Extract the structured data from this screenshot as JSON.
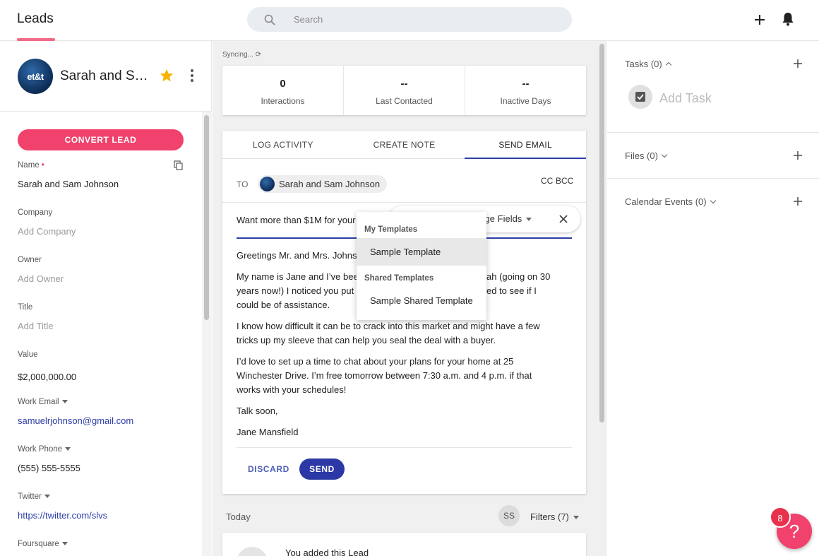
{
  "header": {
    "title": "Leads",
    "search_placeholder": "Search"
  },
  "lead": {
    "name": "Sarah and Sam Johnson",
    "avatar_text": "et&t",
    "convert_label": "CONVERT LEAD",
    "fields": {
      "name_label": "Name",
      "name_required": "•",
      "name_value": "Sarah and Sam Johnson",
      "company_label": "Company",
      "company_placeholder": "Add Company",
      "owner_label": "Owner",
      "owner_placeholder": "Add Owner",
      "title_label": "Title",
      "title_placeholder": "Add Title",
      "value_label": "Value",
      "value_value": "$2,000,000.00",
      "work_email_label": "Work Email",
      "work_email_value": "samuelrjohnson@gmail.com",
      "work_phone_label": "Work Phone",
      "work_phone_value": "(555) 555-5555",
      "twitter_label": "Twitter",
      "twitter_value": "https://twitter.com/slvs",
      "foursquare_label": "Foursquare"
    }
  },
  "stats": {
    "syncing": "Syncing...",
    "items": [
      {
        "value": "0",
        "label": "Interactions"
      },
      {
        "value": "--",
        "label": "Last Contacted"
      },
      {
        "value": "--",
        "label": "Inactive Days"
      }
    ]
  },
  "compose": {
    "tabs": [
      "LOG ACTIVITY",
      "CREATE NOTE",
      "SEND EMAIL"
    ],
    "active_tab": "SEND EMAIL",
    "to_label": "TO",
    "recipient": "Sarah and Sam Johnson",
    "cc_label": "CC",
    "bcc_label": "BCC",
    "subject": "Want more than $1M for your",
    "body_lines": [
      "Greetings Mr. and Mrs. Johns",
      "My name is Jane and I’ve bee",
      "ah (going on 30",
      "years now!) I noticed you put y",
      "ed to see if I",
      "could be of assistance.",
      "I know how difficult it can be to crack into this market and might have a few",
      "tricks up my sleeve that can help you seal the deal with a buyer.",
      "I’d love to set up a time to chat about your plans for your home at 25",
      "Winchester Drive. I’m free tomorrow between 7:30 a.m. and 4 p.m. if that",
      "works with your schedules!",
      "Talk soon,",
      "Jane Mansfield"
    ],
    "discard_label": "DISCARD",
    "send_label": "SEND",
    "merge_fields_label": "erge Fields"
  },
  "templates_dropdown": {
    "my_header": "My Templates",
    "my_items": [
      "Sample Template"
    ],
    "shared_header": "Shared Templates",
    "shared_items": [
      "Sample Shared Template"
    ]
  },
  "timeline": {
    "today_label": "Today",
    "user_initials": "SS",
    "filters_label": "Filters (7)",
    "first_activity": "You added this Lead"
  },
  "right_panel": {
    "tasks_label": "Tasks (0)",
    "add_task_label": "Add Task",
    "files_label": "Files (0)",
    "calendar_label": "Calendar Events (0)"
  },
  "help": {
    "badge_count": "8",
    "icon": "?"
  },
  "colors": {
    "accent_pink": "#f0426c",
    "primary_blue": "#2b38a5",
    "star": "#f4b400"
  }
}
